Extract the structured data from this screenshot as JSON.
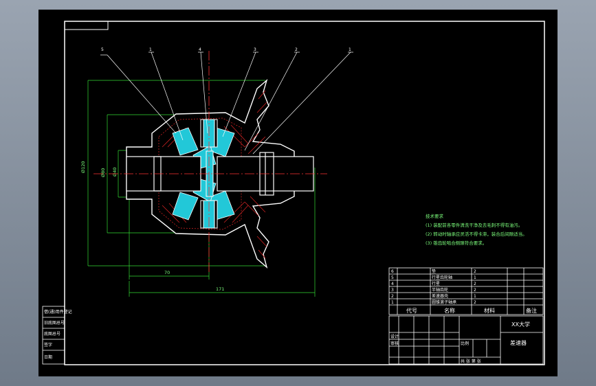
{
  "colors": {
    "background": "#7c8796",
    "sheet": "#000000",
    "border": "#ffffff",
    "dimension": "#33dd33",
    "centerline": "#ff3333",
    "hatch": "#cc2222",
    "bearing": "#22c8d8",
    "leader": "#ffffff",
    "note_text": "#7dff7d"
  },
  "leader_numbers": [
    "5",
    "1",
    "4",
    "3",
    "2",
    "1"
  ],
  "dimensions": {
    "overall_height": "Ø120",
    "inner_height": "Ø80",
    "bore": "Ø40",
    "half_width": "70",
    "total_width": "171"
  },
  "notes": {
    "title": "技术要求",
    "lines": [
      "(1) 装配前各零件清洗干净及去毛刺不得有油污。",
      "(2) 转动时轴承应灵活不得卡滞，装合后间隙适当。",
      "(3) 锥齿轮啮合侧隙符合要求。"
    ]
  },
  "parts_list": {
    "rows": [
      {
        "no": "6",
        "name": "垫",
        "qty": "2"
      },
      {
        "no": "5",
        "name": "行星齿轮轴",
        "qty": "1"
      },
      {
        "no": "4",
        "name": "行星",
        "qty": "2"
      },
      {
        "no": "3",
        "name": "半轴齿轮",
        "qty": "2"
      },
      {
        "no": "2",
        "name": "差速器壳",
        "qty": "1"
      },
      {
        "no": "1",
        "name": "圆锥滚子轴承",
        "qty": "2"
      }
    ],
    "headers": {
      "code": "代号",
      "name": "名称",
      "material": "材料",
      "remark": "备注"
    }
  },
  "title_block": {
    "school": "XX大学",
    "drawing_name": "差速器",
    "label_design": "设计",
    "label_check": "审核",
    "label_scale": "比例",
    "label_sheet": "共 张 第 张"
  },
  "side_stamp": {
    "lines": [
      "借(通)用件登记",
      "旧底图总号",
      "底图总号",
      "签字",
      "日期"
    ]
  }
}
